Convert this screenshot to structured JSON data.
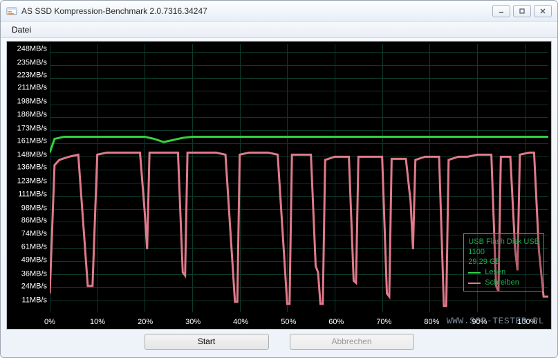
{
  "window": {
    "title": "AS SSD Kompression-Benchmark 2.0.7316.34247"
  },
  "menu": {
    "file": "Datei"
  },
  "buttons": {
    "start": "Start",
    "cancel": "Abbrechen"
  },
  "legend": {
    "device_line1": "USB Flash Disk USB",
    "device_line2": "1100",
    "capacity": "29,29 GB",
    "read_label": "Lesen",
    "write_label": "Schreiben",
    "read_color": "#34d13f",
    "write_color": "#e07a8a"
  },
  "watermark": "www.ssd-tester.pl",
  "chart_data": {
    "type": "line",
    "xlabel": "",
    "ylabel": "",
    "y_unit": "MB/s",
    "x_unit": "%",
    "xlim": [
      0,
      105
    ],
    "ylim": [
      0,
      255
    ],
    "y_ticks": [
      11,
      24,
      36,
      49,
      61,
      74,
      86,
      98,
      111,
      123,
      136,
      148,
      161,
      173,
      186,
      198,
      211,
      223,
      235,
      248
    ],
    "x_ticks": [
      0,
      10,
      20,
      30,
      40,
      50,
      60,
      70,
      80,
      90,
      100
    ],
    "series": [
      {
        "name": "Lesen",
        "color": "#34d13f",
        "points": [
          [
            0,
            152
          ],
          [
            1,
            165
          ],
          [
            3,
            167
          ],
          [
            5,
            167
          ],
          [
            8,
            167
          ],
          [
            12,
            167
          ],
          [
            16,
            167
          ],
          [
            20,
            167
          ],
          [
            22,
            165
          ],
          [
            24,
            162
          ],
          [
            26,
            164
          ],
          [
            28,
            166
          ],
          [
            30,
            167
          ],
          [
            34,
            167
          ],
          [
            38,
            167
          ],
          [
            42,
            167
          ],
          [
            46,
            167
          ],
          [
            50,
            167
          ],
          [
            54,
            167
          ],
          [
            58,
            167
          ],
          [
            62,
            167
          ],
          [
            66,
            167
          ],
          [
            70,
            167
          ],
          [
            74,
            167
          ],
          [
            78,
            167
          ],
          [
            82,
            167
          ],
          [
            86,
            167
          ],
          [
            90,
            167
          ],
          [
            94,
            167
          ],
          [
            98,
            167
          ],
          [
            101,
            167
          ],
          [
            105,
            167
          ]
        ]
      },
      {
        "name": "Schreiben",
        "color": "#e07a8a",
        "points": [
          [
            0,
            18
          ],
          [
            1,
            140
          ],
          [
            2,
            145
          ],
          [
            4,
            148
          ],
          [
            6,
            150
          ],
          [
            8,
            25
          ],
          [
            9,
            25
          ],
          [
            10,
            150
          ],
          [
            12,
            152
          ],
          [
            14,
            152
          ],
          [
            16,
            152
          ],
          [
            18,
            152
          ],
          [
            19,
            152
          ],
          [
            20,
            95
          ],
          [
            20.5,
            60
          ],
          [
            21,
            152
          ],
          [
            23,
            152
          ],
          [
            26,
            152
          ],
          [
            27,
            152
          ],
          [
            28,
            38
          ],
          [
            28.5,
            35
          ],
          [
            29,
            152
          ],
          [
            31,
            152
          ],
          [
            33,
            152
          ],
          [
            35,
            152
          ],
          [
            37,
            150
          ],
          [
            39,
            10
          ],
          [
            39.5,
            10
          ],
          [
            40,
            150
          ],
          [
            42,
            152
          ],
          [
            44,
            152
          ],
          [
            46,
            152
          ],
          [
            48,
            150
          ],
          [
            50,
            8
          ],
          [
            50.5,
            8
          ],
          [
            51,
            150
          ],
          [
            53,
            150
          ],
          [
            54,
            150
          ],
          [
            55,
            150
          ],
          [
            56,
            44
          ],
          [
            56.5,
            38
          ],
          [
            57,
            8
          ],
          [
            57.5,
            8
          ],
          [
            58,
            145
          ],
          [
            60,
            148
          ],
          [
            62,
            148
          ],
          [
            63,
            148
          ],
          [
            64,
            30
          ],
          [
            64.5,
            28
          ],
          [
            65,
            148
          ],
          [
            67,
            148
          ],
          [
            69,
            148
          ],
          [
            70,
            148
          ],
          [
            71,
            18
          ],
          [
            71.5,
            15
          ],
          [
            72,
            146
          ],
          [
            74,
            146
          ],
          [
            75,
            146
          ],
          [
            76,
            105
          ],
          [
            76.5,
            60
          ],
          [
            77,
            145
          ],
          [
            79,
            148
          ],
          [
            81,
            148
          ],
          [
            82,
            148
          ],
          [
            83,
            6
          ],
          [
            83.5,
            6
          ],
          [
            84,
            145
          ],
          [
            86,
            148
          ],
          [
            88,
            148
          ],
          [
            90,
            150
          ],
          [
            92,
            150
          ],
          [
            93,
            150
          ],
          [
            94,
            25
          ],
          [
            94.5,
            20
          ],
          [
            95,
            148
          ],
          [
            96,
            148
          ],
          [
            97,
            148
          ],
          [
            98,
            60
          ],
          [
            98.5,
            40
          ],
          [
            99,
            150
          ],
          [
            101,
            152
          ],
          [
            102,
            152
          ],
          [
            103,
            60
          ],
          [
            104,
            15
          ],
          [
            105,
            15
          ]
        ]
      }
    ]
  }
}
